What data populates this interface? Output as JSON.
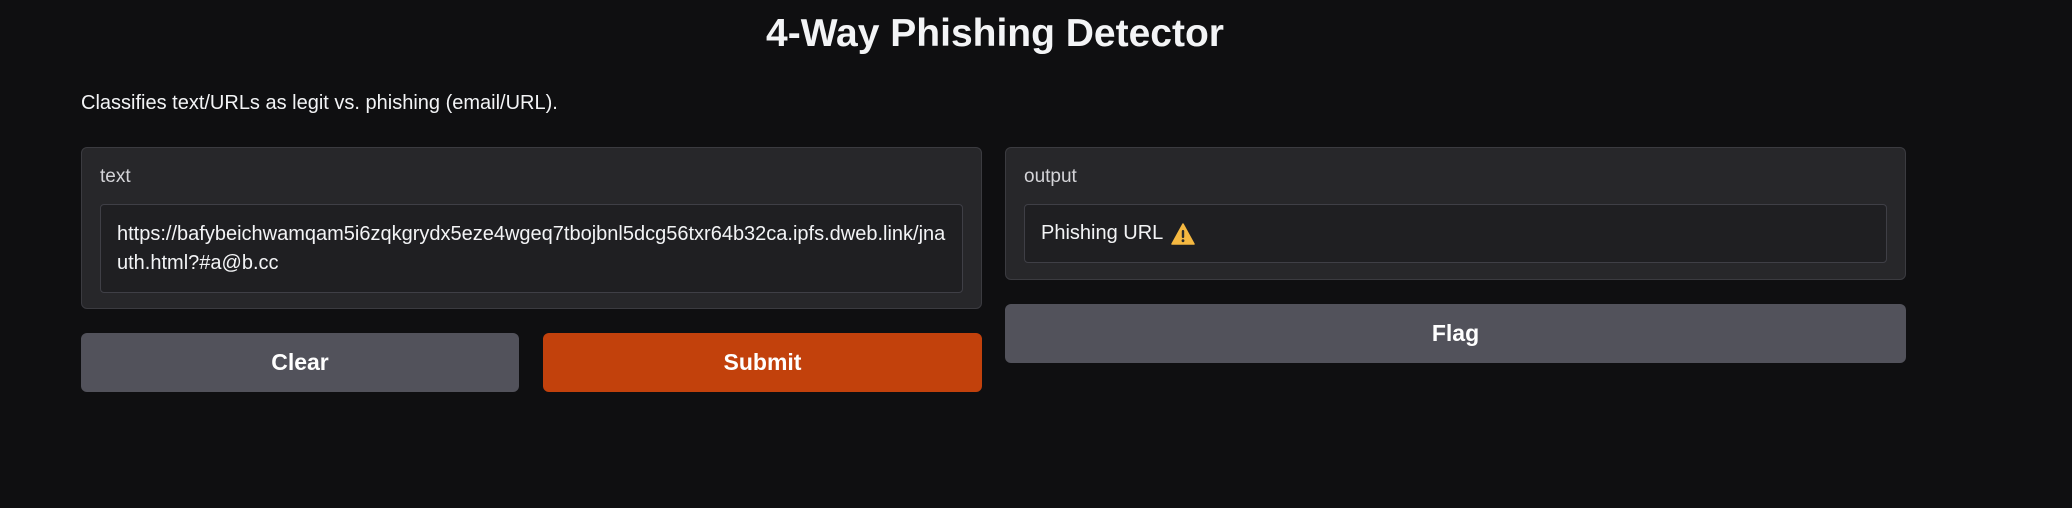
{
  "app": {
    "title": "4-Way Phishing Detector",
    "description": "Classifies text/URLs as legit vs. phishing (email/URL)."
  },
  "input_panel": {
    "label": "text",
    "value": "https://bafybeichwamqam5i6zqkgrydx5eze4wgeq7tbojbnl5dcg56txr64b32ca.ipfs.dweb.link/jnauth.html?#a@b.cc"
  },
  "output_panel": {
    "label": "output",
    "value": "Phishing URL",
    "icon": "warning-icon"
  },
  "buttons": {
    "clear_label": "Clear",
    "submit_label": "Submit",
    "flag_label": "Flag"
  },
  "colors": {
    "background": "#0f0f11",
    "panel": "#27272a",
    "primary": "#c2410c",
    "secondary": "#52525b",
    "warning": "#f5b841"
  }
}
